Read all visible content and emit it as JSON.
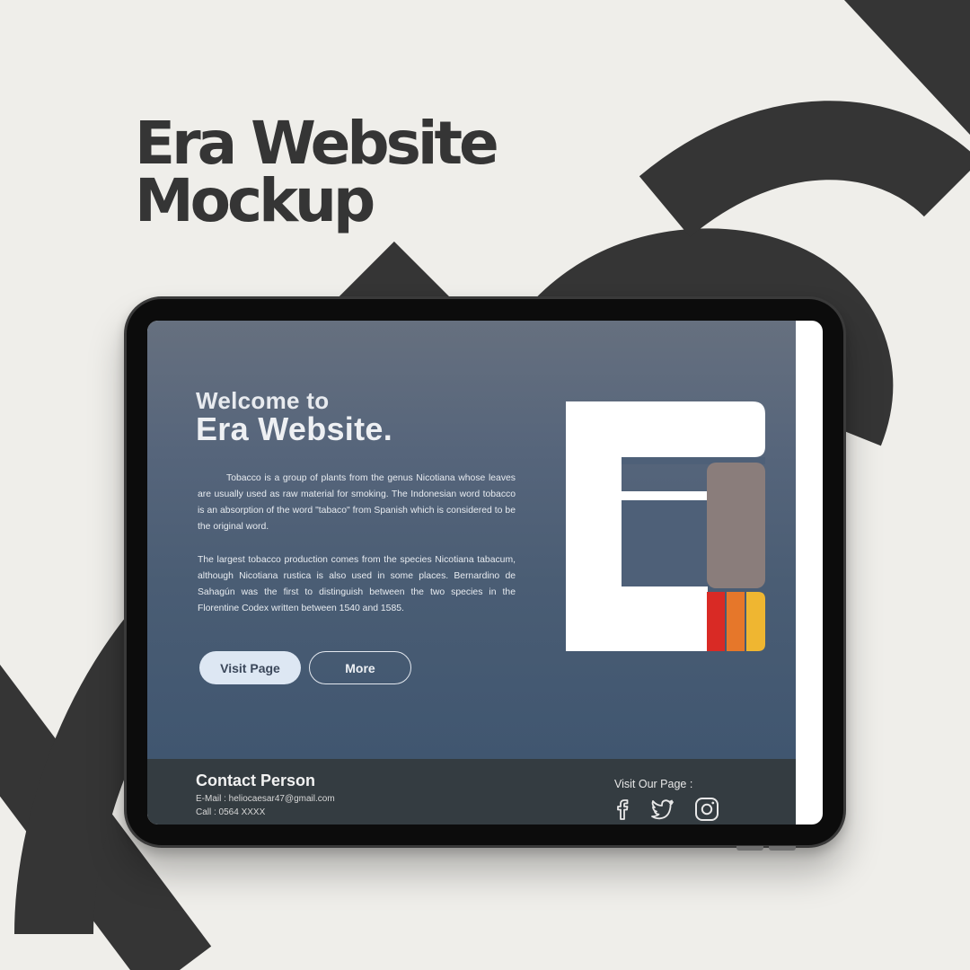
{
  "headline": {
    "line1": "Era Website",
    "line2": "Mockup"
  },
  "hero": {
    "welcome_small": "Welcome to",
    "welcome_big": "Era Website.",
    "paragraph1": "Tobacco is a group of plants from the genus Nicotiana whose leaves are usually used as raw material for smoking. The Indonesian word tobacco is an absorption of the word \"tabaco\" from Spanish which is considered to be the original word.",
    "paragraph2": "The largest tobacco production comes from the species Nicotiana tabacum, although Nicotiana rustica is also used in some places. Bernardino de Sahagún was the first to distinguish between the two species in the Florentine Codex written between 1540 and 1585.",
    "visit_button": "Visit Page",
    "more_button": "More"
  },
  "footer": {
    "contact_title": "Contact Person",
    "email_line": "E-Mail : heliocaesar47@gmail.com",
    "call_line": "Call : 0564 XXXX",
    "visit_label": "Visit Our Page :",
    "social_icons": [
      "facebook-icon",
      "twitter-icon",
      "instagram-icon"
    ]
  },
  "colors": {
    "background": "#efeeea",
    "decor_letters": "#353535",
    "hero_top": "#66707f",
    "hero_bottom": "#405670",
    "footer": "#343c41",
    "logo_taupe": "#8a7d7b",
    "logo_red": "#d92a25",
    "logo_orange": "#e6772a",
    "logo_yellow": "#efb631"
  }
}
